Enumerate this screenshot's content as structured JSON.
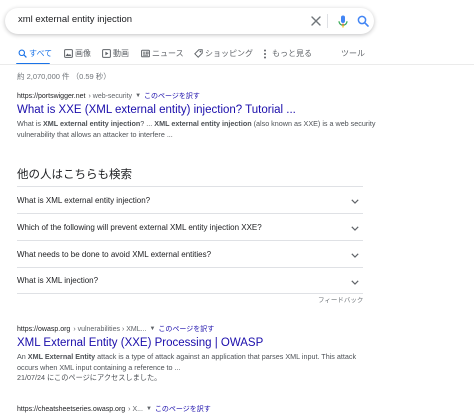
{
  "search": {
    "query": "xml external entity injection"
  },
  "tabs": [
    {
      "label": "すべて",
      "icon": "search-icon",
      "active": true
    },
    {
      "label": "画像",
      "icon": "image-icon",
      "active": false
    },
    {
      "label": "動画",
      "icon": "video-icon",
      "active": false
    },
    {
      "label": "ニュース",
      "icon": "news-icon",
      "active": false
    },
    {
      "label": "ショッピング",
      "icon": "tag-icon",
      "active": false
    },
    {
      "label": "もっと見る",
      "icon": "more-dots-icon",
      "active": false
    }
  ],
  "tools_label": "ツール",
  "result_stats": "約 2,070,000 件 （0.59 秒）",
  "results": [
    {
      "site": "https://portswigger.net",
      "crumb": "› web-security",
      "translate": "このページを訳す",
      "title": "What is XXE (XML external entity) injection? Tutorial ...",
      "snippet_html": "What is <b>XML external entity injection</b>? ... <b>XML external entity injection</b> (also known as XXE) is a web security vulnerability that allows an attacker to interfere ..."
    },
    {
      "site": "https://owasp.org",
      "crumb": "› vulnerabilities › XML...",
      "translate": "このページを訳す",
      "title": "XML External Entity (XXE) Processing | OWASP",
      "snippet_html": "An <b>XML External Entity</b> attack is a type of attack against an application that parses XML input. This attack occurs when XML input containing a reference to ...<br>21/07/24 にこのページにアクセスしました。"
    },
    {
      "site": "https://cheatsheetseries.owasp.org",
      "crumb": "› X...",
      "translate": "このページを訳す"
    }
  ],
  "paa": {
    "heading": "他の人はこちらも検索",
    "questions": [
      "What is XML external entity injection?",
      "Which of the following will prevent external XML entity injection XXE?",
      "What needs to be done to avoid XML external entities?",
      "What is XML injection?"
    ],
    "feedback": "フィードバック"
  },
  "colors": {
    "link": "#1a0dab",
    "accent": "#1a73e8",
    "text": "#202124",
    "muted": "#70757a"
  }
}
